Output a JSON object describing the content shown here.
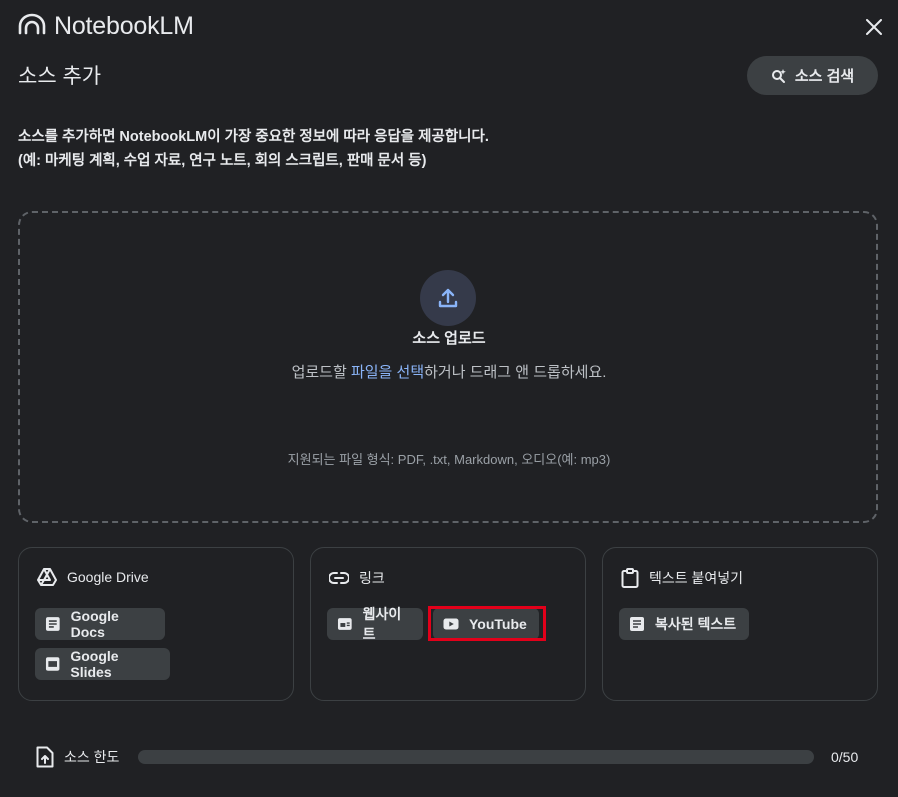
{
  "header": {
    "brand": "NotebookLM"
  },
  "dialog": {
    "title": "소스 추가",
    "search_label": "소스 검색",
    "description_line1": "소스를 추가하면 NotebookLM이 가장 중요한 정보에 따라 응답을 제공합니다.",
    "description_line2": "(예: 마케팅 계획, 수업 자료, 연구 노트, 회의 스크립트, 판매 문서 등)"
  },
  "upload": {
    "title": "소스 업로드",
    "desc_prefix": "업로드할 ",
    "desc_link": "파일을 선택",
    "desc_suffix": "하거나 드래그 앤 드롭하세요.",
    "formats": "지원되는 파일 형식: PDF, .txt, Markdown, 오디오(예: mp3)"
  },
  "cards": {
    "drive": {
      "title": "Google Drive",
      "docs": "Google Docs",
      "slides": "Google Slides"
    },
    "link": {
      "title": "링크",
      "website": "웹사이트",
      "youtube": "YouTube"
    },
    "paste": {
      "title": "텍스트 붙여넣기",
      "copied": "복사된 텍스트"
    }
  },
  "quota": {
    "label": "소스 한도",
    "count": "0/50",
    "progress": 0
  },
  "colors": {
    "background": "#202124",
    "accent": "#8ab4f8",
    "highlight": "#e2001a"
  }
}
